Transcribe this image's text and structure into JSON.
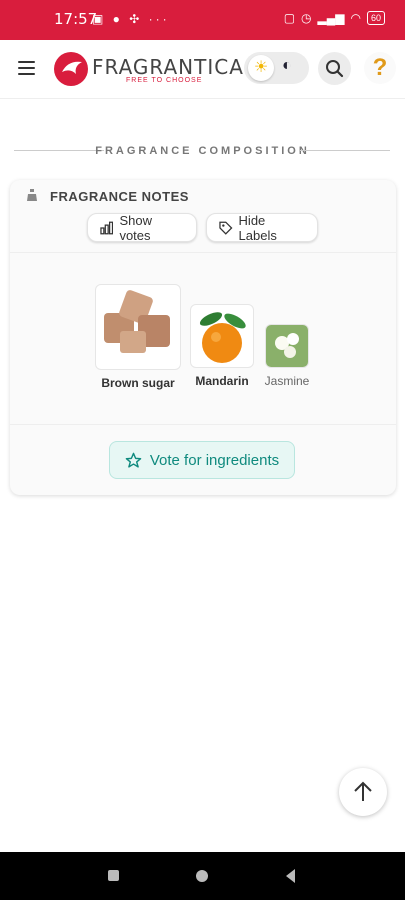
{
  "status_bar": {
    "time": "17:57",
    "battery": "60"
  },
  "header": {
    "brand": "FRAGRANTICA",
    "tagline": "FREE TO CHOOSE",
    "theme": "light"
  },
  "section": {
    "title": "FRAGRANCE COMPOSITION"
  },
  "notes_card": {
    "title": "FRAGRANCE NOTES",
    "show_votes_label": "Show votes",
    "hide_labels_label": "Hide Labels",
    "notes": [
      {
        "name": "Brown sugar",
        "icon": "brown-sugar-cubes"
      },
      {
        "name": "Mandarin",
        "icon": "mandarin-orange"
      },
      {
        "name": "Jasmine",
        "icon": "jasmine-flowers"
      }
    ],
    "vote_label": "Vote for ingredients"
  },
  "colors": {
    "brand_red": "#d91d3d",
    "teal_accent": "#0f8a7e"
  }
}
